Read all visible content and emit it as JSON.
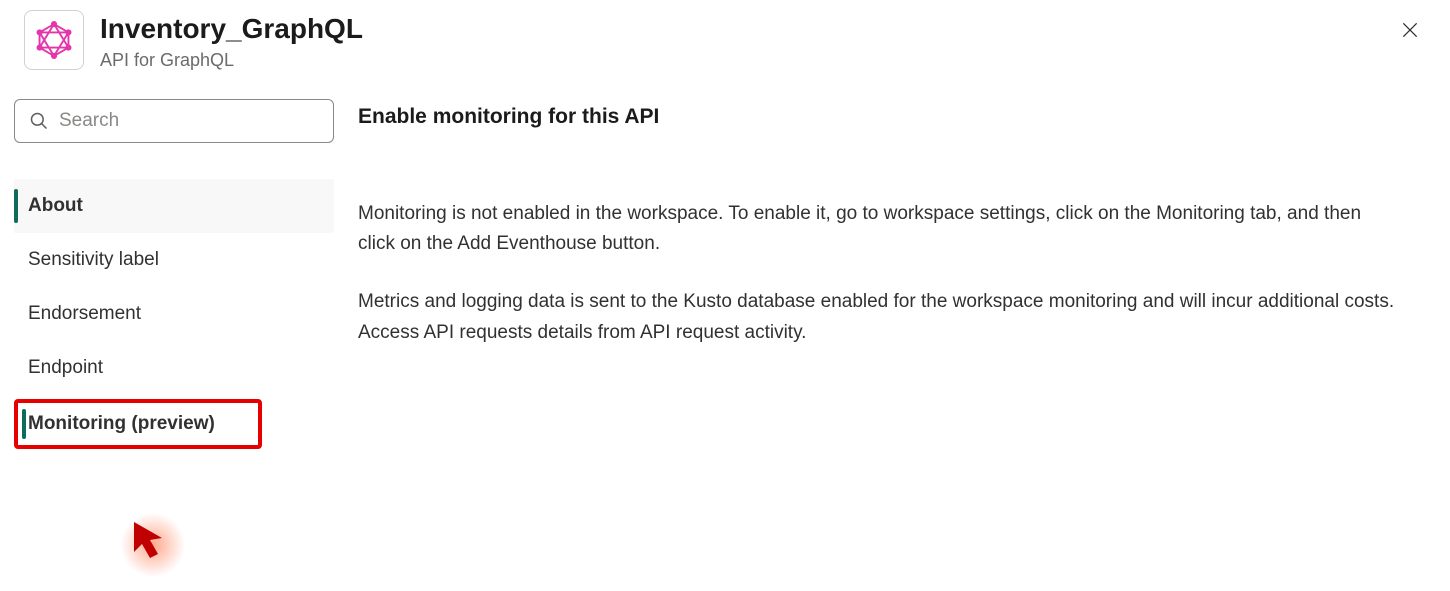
{
  "header": {
    "title": "Inventory_GraphQL",
    "subtitle": "API for GraphQL"
  },
  "search": {
    "placeholder": "Search"
  },
  "sidebar": {
    "items": [
      {
        "label": "About"
      },
      {
        "label": "Sensitivity label"
      },
      {
        "label": "Endorsement"
      },
      {
        "label": "Endpoint"
      },
      {
        "label": "Monitoring (preview)"
      }
    ]
  },
  "main": {
    "heading": "Enable monitoring for this API",
    "paragraph1": "Monitoring is not enabled in the workspace. To enable it, go to workspace settings, click on the Monitoring tab, and then click on the Add Eventhouse button.",
    "paragraph2": "Metrics and logging data is sent to the Kusto database enabled for the workspace monitoring and will incur additional costs. Access API requests details from API request activity."
  }
}
